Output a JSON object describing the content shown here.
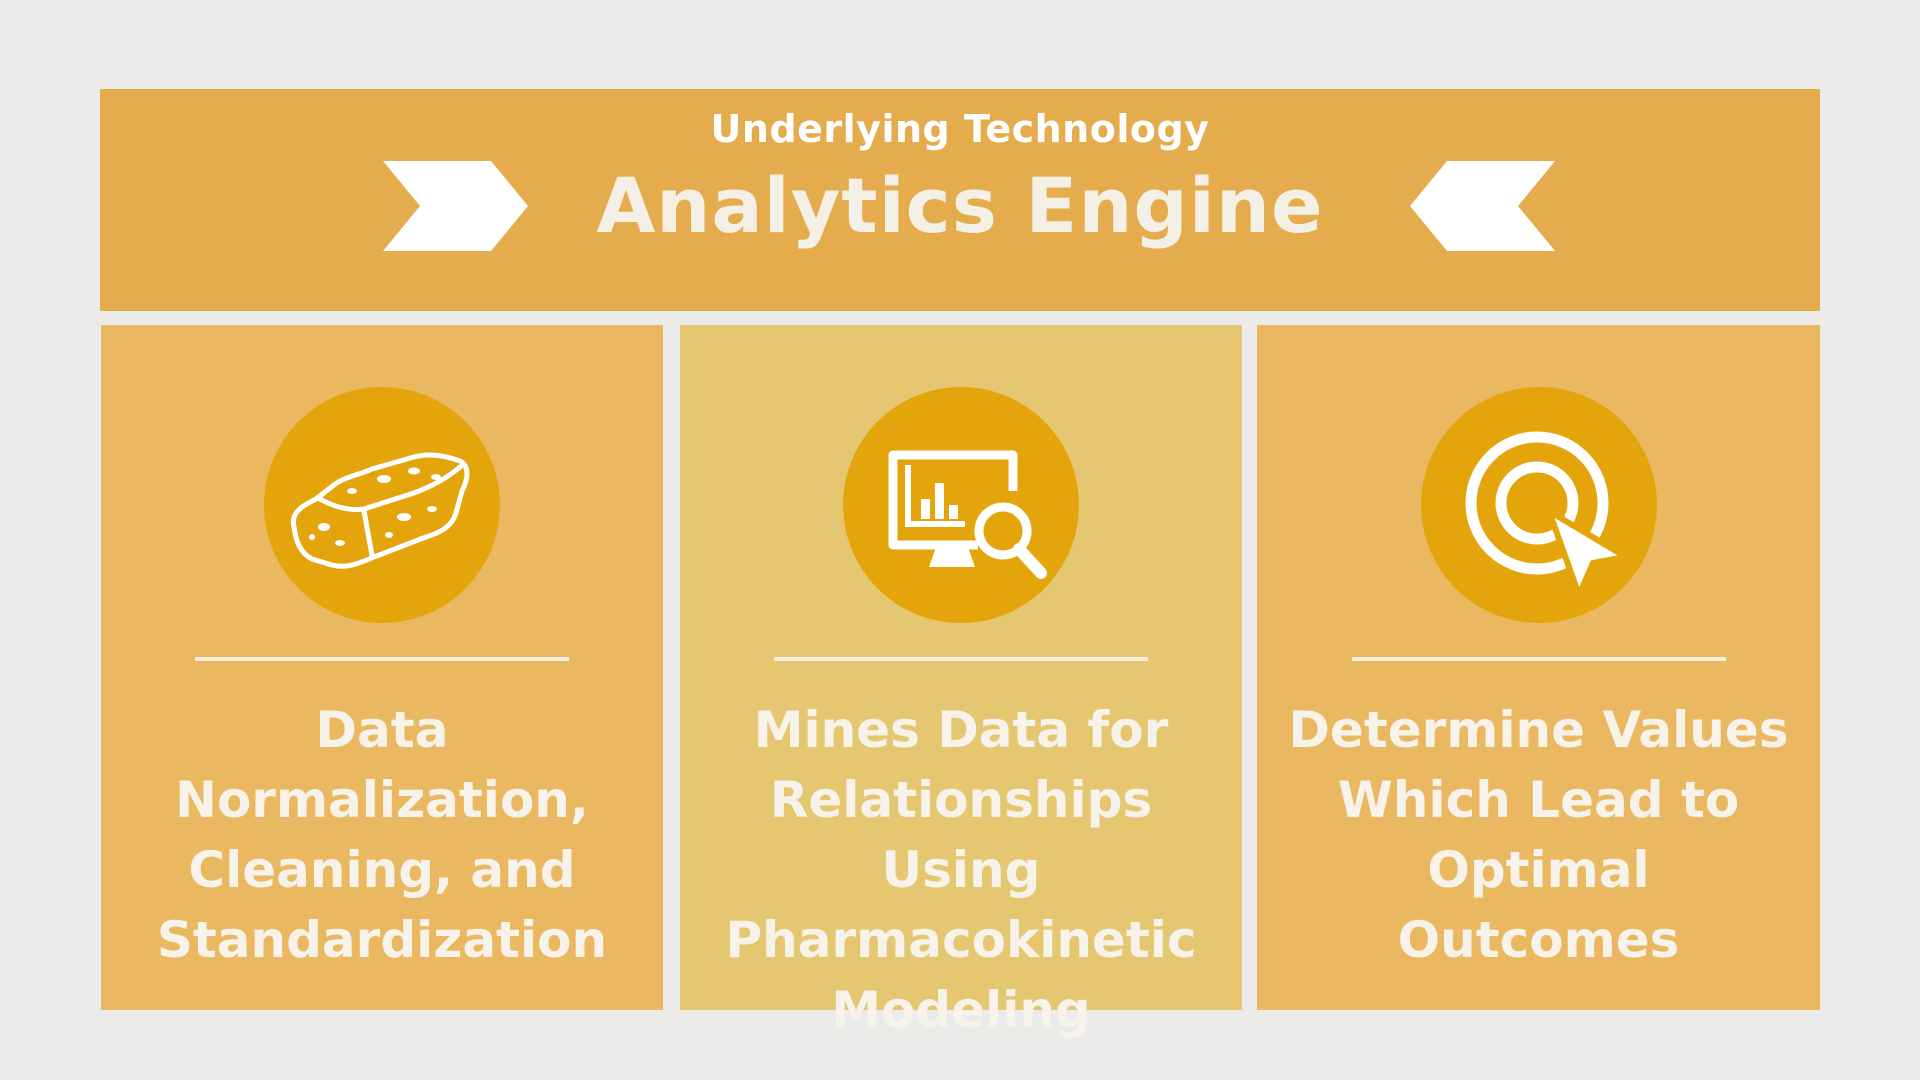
{
  "header": {
    "subtitle": "Underlying Technology",
    "title": "Analytics Engine"
  },
  "cards": [
    {
      "icon": "sponge-icon",
      "lines": [
        "Data",
        "Normalization,",
        "Cleaning, and",
        "Standardization"
      ]
    },
    {
      "icon": "monitor-search-icon",
      "lines": [
        "Mines Data for",
        "Relationships Using",
        "Pharmacokinetic",
        "Modeling"
      ]
    },
    {
      "icon": "target-cursor-icon",
      "lines": [
        "Determine Values",
        "Which Lead to",
        "Optimal",
        "Outcomes"
      ]
    }
  ],
  "colors": {
    "background": "#ebebea",
    "header": "#e5ac4e",
    "card_outer": "#e9b860",
    "card_middle": "#e5c771",
    "icon_circle": "#e3a40c",
    "text": "#f7f2ea"
  }
}
